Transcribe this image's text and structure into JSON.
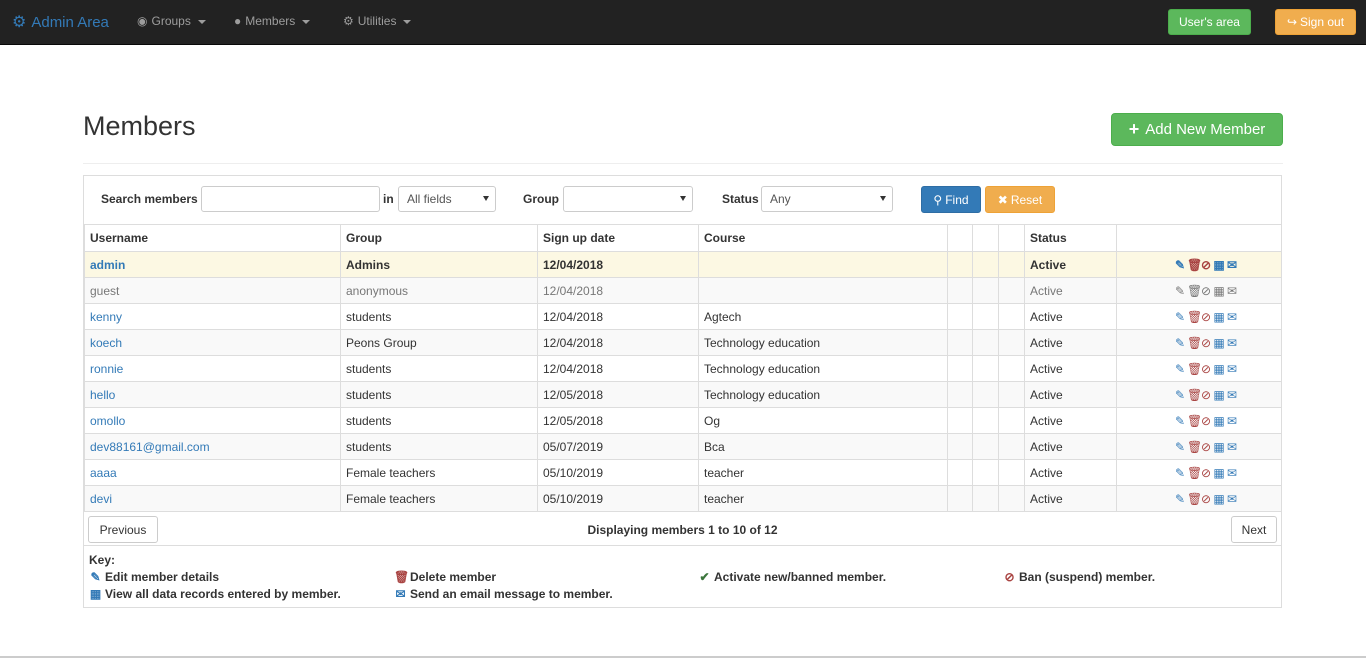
{
  "nav": {
    "brand": "Admin Area",
    "menus": [
      {
        "label": "Groups",
        "icon": "globe-icon"
      },
      {
        "label": "Members",
        "icon": "user-icon"
      },
      {
        "label": "Utilities",
        "icon": "cog-icon"
      }
    ],
    "users_area": "User's area",
    "sign_out": "Sign out"
  },
  "header": {
    "title": "Members",
    "add_button": "Add New Member"
  },
  "search": {
    "label": "Search members",
    "value": "",
    "in_label": "in",
    "field_select": "All fields",
    "group_label": "Group",
    "group_select": "",
    "status_label": "Status",
    "status_select": "Any",
    "find": "Find",
    "reset": "Reset"
  },
  "table": {
    "columns": [
      "Username",
      "Group",
      "Sign up date",
      "Course",
      "",
      "",
      "",
      "Status",
      ""
    ],
    "rows": [
      {
        "username": "admin",
        "group": "Admins",
        "date": "12/04/2018",
        "course": "",
        "status": "Active"
      },
      {
        "username": "guest",
        "group": "anonymous",
        "date": "12/04/2018",
        "course": "",
        "status": "Active"
      },
      {
        "username": "kenny",
        "group": "students",
        "date": "12/04/2018",
        "course": "Agtech",
        "status": "Active"
      },
      {
        "username": "koech",
        "group": "Peons Group",
        "date": "12/04/2018",
        "course": "Technology education",
        "status": "Active"
      },
      {
        "username": "ronnie",
        "group": "students",
        "date": "12/04/2018",
        "course": "Technology education",
        "status": "Active"
      },
      {
        "username": "hello",
        "group": "students",
        "date": "12/05/2018",
        "course": "Technology education",
        "status": "Active"
      },
      {
        "username": "omollo",
        "group": "students",
        "date": "12/05/2018",
        "course": "Og",
        "status": "Active"
      },
      {
        "username": "dev88161@gmail.com",
        "group": "students",
        "date": "05/07/2019",
        "course": "Bca",
        "status": "Active"
      },
      {
        "username": "aaaa",
        "group": "Female teachers",
        "date": "05/10/2019",
        "course": "teacher",
        "status": "Active"
      },
      {
        "username": "devi",
        "group": "Female teachers",
        "date": "05/10/2019",
        "course": "teacher",
        "status": "Active"
      }
    ]
  },
  "pager": {
    "previous": "Previous",
    "next": "Next",
    "text": "Displaying members 1 to 10 of 12"
  },
  "key": {
    "title": "Key:",
    "edit": "Edit member details",
    "delete": "Delete member",
    "activate": "Activate new/banned member.",
    "ban": "Ban (suspend) member.",
    "records": "View all data records entered by member.",
    "email": "Send an email message to member."
  },
  "colors": {
    "primary": "#337ab7",
    "success": "#5cb85c",
    "warning": "#f0ad4e",
    "danger": "#a94442",
    "navbar": "#222222"
  }
}
